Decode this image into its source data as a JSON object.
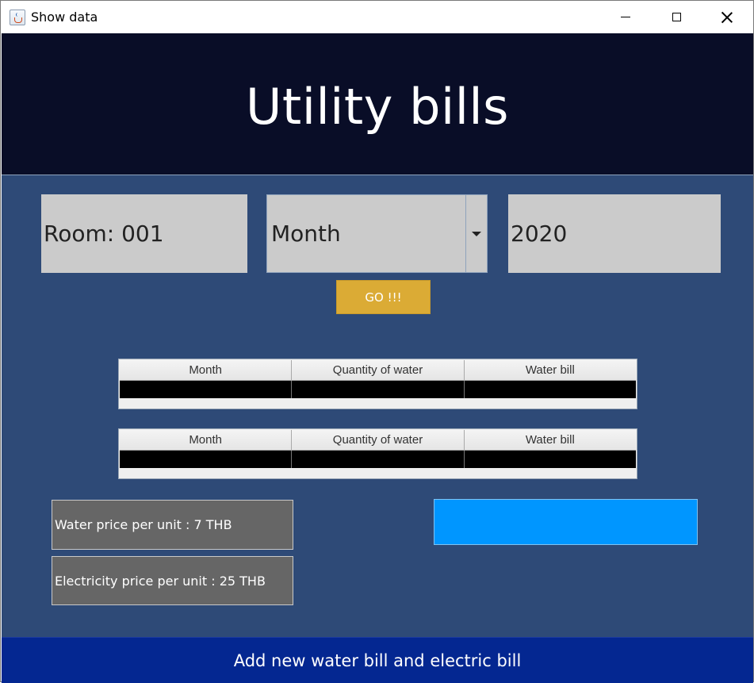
{
  "window": {
    "title": "Show data"
  },
  "header": {
    "title": "Utility bills"
  },
  "filters": {
    "room_label": "Room: 001",
    "month_selected": "Month",
    "year_value": "2020",
    "go_label": "GO !!!"
  },
  "tables": [
    {
      "columns": [
        "Month",
        "Quantity of water",
        "Water bill"
      ],
      "rows": [
        [
          "",
          "",
          ""
        ]
      ]
    },
    {
      "columns": [
        "Month",
        "Quantity of water",
        "Water bill"
      ],
      "rows": [
        [
          "",
          "",
          ""
        ]
      ]
    }
  ],
  "info": {
    "water_price": "Water price per unit : 7 THB",
    "electricity_price": "Electricity price per unit : 25 THB"
  },
  "footer": {
    "add_button_label": "Add new water bill and electric bill"
  },
  "colors": {
    "header_bg": "#090d27",
    "content_bg": "#2e4a77",
    "go_button": "#dbab35",
    "blue_panel": "#0096ff",
    "footer_bg": "#042791"
  },
  "icons": {
    "app": "java-cup-icon",
    "minimize": "minimize-icon",
    "maximize": "maximize-icon",
    "close": "close-icon",
    "dropdown": "chevron-down-icon"
  }
}
